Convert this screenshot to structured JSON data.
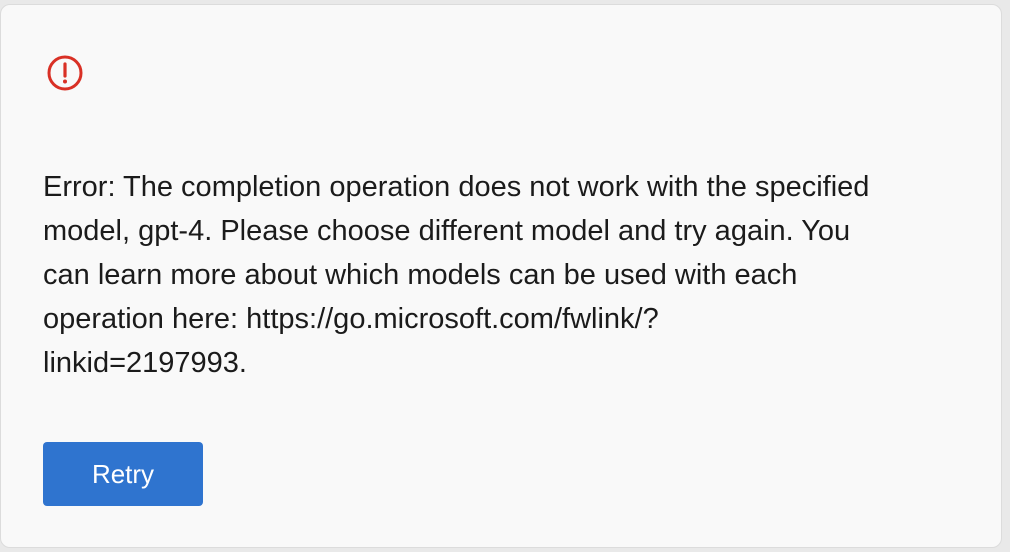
{
  "dialog": {
    "icon": "error-circle-icon",
    "icon_color": "#d93025",
    "message": "Error: The completion operation does not work with the specified\nmodel, gpt-4. Please choose different model and try again. You\ncan learn more about which models can be used with each\noperation here: https://go.microsoft.com/fwlink/?\nlinkid=2197993.",
    "retry_label": "Retry",
    "accent": "#2f74cf"
  }
}
